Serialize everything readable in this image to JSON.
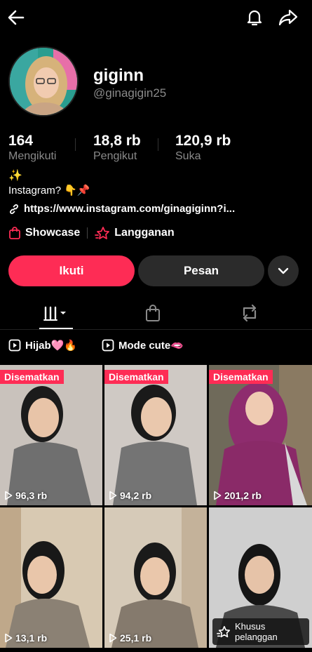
{
  "profile": {
    "username": "giginn",
    "handle": "@ginagigin25"
  },
  "stats": [
    {
      "value": "164",
      "label": "Mengikuti"
    },
    {
      "value": "18,8 rb",
      "label": "Pengikut"
    },
    {
      "value": "120,9 rb",
      "label": "Suka"
    }
  ],
  "bio": {
    "emoji": "✨",
    "text": "Instagram? 👇📌",
    "link": "https://www.instagram.com/ginagiginn?i..."
  },
  "shop": {
    "showcase": "Showcase",
    "subscription": "Langganan"
  },
  "actions": {
    "follow": "Ikuti",
    "message": "Pesan"
  },
  "playlists": [
    {
      "label": "Hijab🩷🔥"
    },
    {
      "label": "Mode cute🫦"
    }
  ],
  "videos": [
    {
      "views": "96,3 rb",
      "pinned": "Disematkan"
    },
    {
      "views": "94,2 rb",
      "pinned": "Disematkan"
    },
    {
      "views": "201,2 rb",
      "pinned": "Disematkan"
    },
    {
      "views": "13,1 rb"
    },
    {
      "views": "25,1 rb"
    },
    {
      "badge": "Khusus pelanggan"
    }
  ],
  "colors": {
    "accent": "#fe2c55",
    "secondary_button": "#2b2b2b",
    "muted_text": "#8a8a8a"
  }
}
